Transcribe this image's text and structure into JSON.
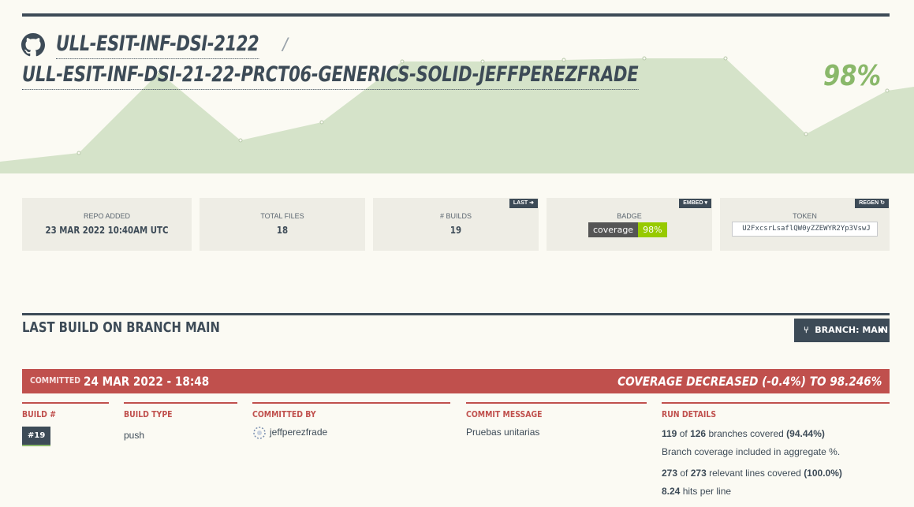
{
  "header": {
    "org": "ULL-ESIT-INF-DSI-2122",
    "separator": "/",
    "repo": "ULL-ESIT-INF-DSI-21-22-PRCT06-GENERICS-SOLID-JEFFPEREZFRADE",
    "coverage_pct": "98%"
  },
  "stats": {
    "repo_added": {
      "label": "REPO ADDED",
      "value": "23 MAR 2022 10:40AM UTC"
    },
    "total_files": {
      "label": "TOTAL FILES",
      "value": "18"
    },
    "builds": {
      "label": "# BUILDS",
      "value": "19",
      "button": "LAST"
    },
    "badge": {
      "label": "BADGE",
      "button": "EMBED ▾",
      "left": "coverage",
      "right": "98%"
    },
    "token": {
      "label": "TOKEN",
      "button": "REGEN",
      "value": "U2FxcsrLsaflQW0yZZEWYR2Yp3VswJ"
    }
  },
  "last_build": {
    "title": "LAST BUILD ON BRANCH MAIN",
    "branch_button": "BRANCH: MAIN",
    "committed_label": "COMMITTED",
    "committed_at": "24 MAR 2022 - 18:48",
    "coverage_change": "COVERAGE DECREASED (-0.4%) TO 98.246%",
    "columns": {
      "build_num": {
        "head": "BUILD #",
        "value": "#19"
      },
      "build_type": {
        "head": "BUILD TYPE",
        "value": "push"
      },
      "committed_by": {
        "head": "COMMITTED BY",
        "value": "jeffperezfrade"
      },
      "commit_message": {
        "head": "COMMIT MESSAGE",
        "value": "Pruebas unitarias"
      },
      "run_details": {
        "head": "RUN DETAILS",
        "branches_covered": "119",
        "of1": "of",
        "branches_total": "126",
        "branches_text": "branches covered",
        "branches_pct": "(94.44%)",
        "aggregate_note": "Branch coverage included in aggregate %.",
        "lines_covered": "273",
        "of2": "of",
        "lines_total": "273",
        "lines_text": "relevant lines covered",
        "lines_pct": "(100.0%)",
        "hits": "8.24",
        "hits_text": "hits per line"
      }
    }
  },
  "colors": {
    "dark": "#3d4b57",
    "accent_green": "#8ab86a",
    "area_fill": "#d5e3c9",
    "red": "#c0504d",
    "badge_green": "#97ca00"
  }
}
